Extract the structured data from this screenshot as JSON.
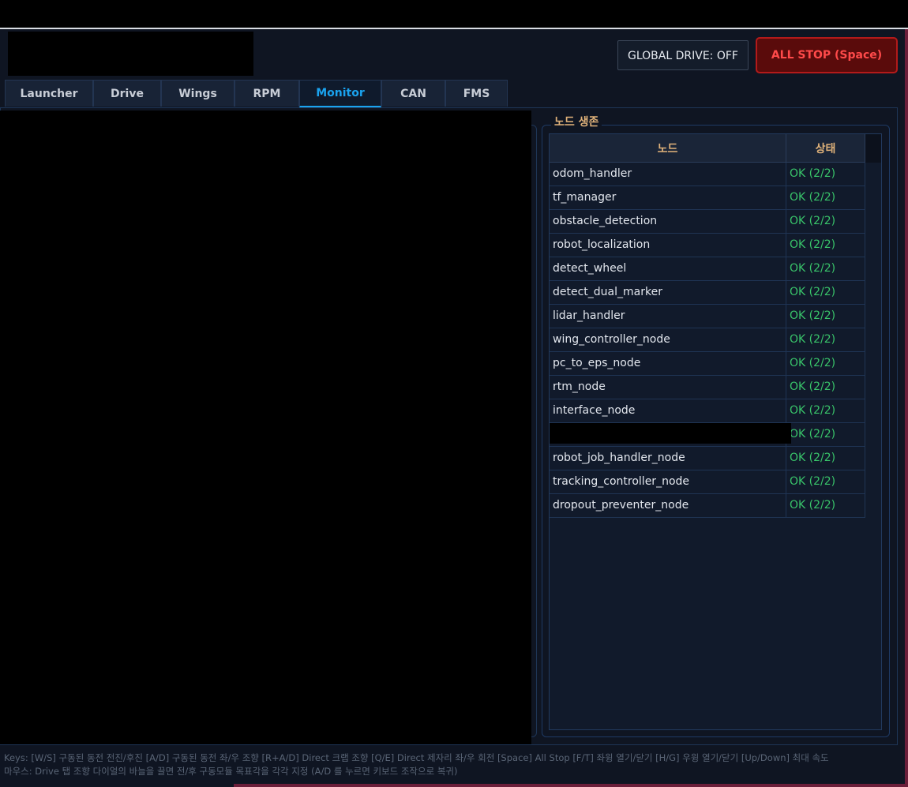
{
  "header": {
    "global_drive_label": "GLOBAL DRIVE: OFF",
    "all_stop_label": "ALL STOP (Space)"
  },
  "tabs": [
    {
      "label": "Launcher",
      "active": false
    },
    {
      "label": "Drive",
      "active": false
    },
    {
      "label": "Wings",
      "active": false
    },
    {
      "label": "RPM",
      "active": false
    },
    {
      "label": "Monitor",
      "active": true
    },
    {
      "label": "CAN",
      "active": false
    },
    {
      "label": "FMS",
      "active": false
    }
  ],
  "node_panel": {
    "title": "노드 생존",
    "columns": {
      "node": "노드",
      "state": "상태"
    },
    "rows": [
      {
        "node": "odom_handler",
        "state": "OK (2/2)"
      },
      {
        "node": "tf_manager",
        "state": "OK (2/2)"
      },
      {
        "node": "obstacle_detection",
        "state": "OK (2/2)"
      },
      {
        "node": "robot_localization",
        "state": "OK (2/2)"
      },
      {
        "node": "detect_wheel",
        "state": "OK (2/2)"
      },
      {
        "node": "detect_dual_marker",
        "state": "OK (2/2)"
      },
      {
        "node": "lidar_handler",
        "state": "OK (2/2)"
      },
      {
        "node": "wing_controller_node",
        "state": "OK (2/2)"
      },
      {
        "node": "pc_to_eps_node",
        "state": "OK (2/2)"
      },
      {
        "node": "rtm_node",
        "state": "OK (2/2)"
      },
      {
        "node": "interface_node",
        "state": "OK (2/2)"
      },
      {
        "node": "",
        "state": "OK (2/2)",
        "redacted": true
      },
      {
        "node": "robot_job_handler_node",
        "state": "OK (2/2)"
      },
      {
        "node": "tracking_controller_node",
        "state": "OK (2/2)"
      },
      {
        "node": "dropout_preventer_node",
        "state": "OK (2/2)"
      }
    ]
  },
  "footer": {
    "line1_prefix": "Keys: [W/S] 구동된 동전 전진/후진  [A/D] 구동된 동전 좌/우 조향  [R+A/D] Direct 크랩 조향  [Q/E] Direct 제자리 좌/우 회전  ",
    "line1_suffix": "[Space] All Stop  [F/T] 좌윙 열기/닫기  [H/G] 우윙 열기/닫기  [Up/Down] 최대 속도",
    "line2": "마우스: Drive 탭 조향 다이얼의 바늘을 끌면 전/후 구동모듈 목표각을 각각 지정 (A/D 를 누르면 키보드 조작으로 복귀)"
  }
}
